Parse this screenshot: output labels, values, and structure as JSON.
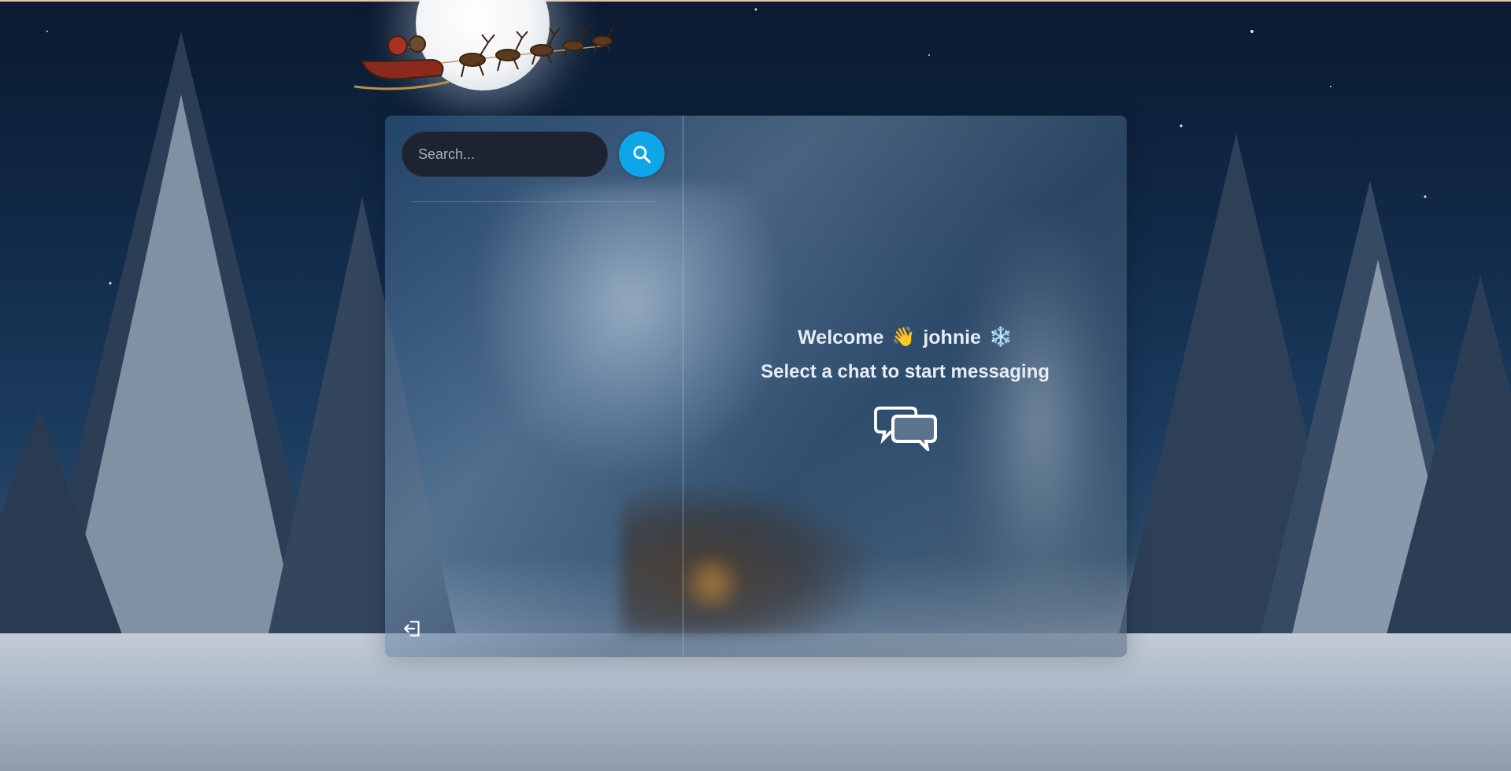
{
  "search": {
    "placeholder": "Search..."
  },
  "welcome": {
    "greeting": "Welcome",
    "wave_emoji": "👋",
    "username": "johnie",
    "snow_emoji": "❄️",
    "subtitle": "Select a chat to start messaging"
  },
  "icons": {
    "search": "search-icon",
    "logout": "logout-icon",
    "chat": "chat-bubbles-icon"
  },
  "colors": {
    "accent": "#0ea5e9",
    "search_bg": "#1d2330",
    "text": "#e6ecf3"
  }
}
